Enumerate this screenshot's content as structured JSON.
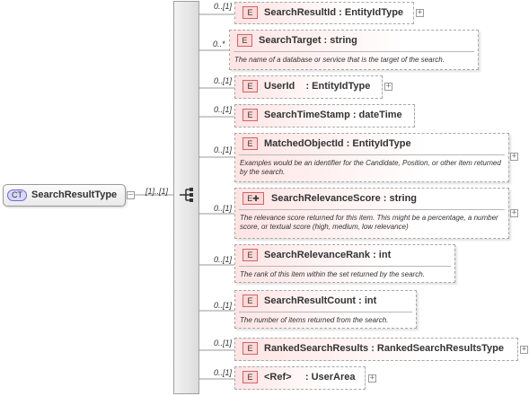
{
  "root": {
    "badge": "CT",
    "name": "SearchResultType",
    "occurrence": "[1]..[1]"
  },
  "elements": [
    {
      "badge": "E",
      "occ": "0..[1]",
      "name": "SearchResultId : EntityIdType",
      "doc": "",
      "expandable": true
    },
    {
      "badge": "E",
      "occ": "0..*",
      "name": "SearchTarget : string",
      "doc": "The name of a database or service that is the target of the search.",
      "expandable": false
    },
    {
      "badge": "E",
      "occ": "0..[1]",
      "name": "UserId    : EntityIdType",
      "doc": "",
      "expandable": true
    },
    {
      "badge": "E",
      "occ": "0..[1]",
      "name": "SearchTimeStamp : dateTime",
      "doc": "",
      "expandable": false
    },
    {
      "badge": "E",
      "occ": "0..[1]",
      "name": "MatchedObjectId : EntityIdType",
      "doc": "Examples would be an identifier for the Candidate, Position, or other item returned by the search.",
      "expandable": true
    },
    {
      "badge": "E✚",
      "occ": "0..[1]",
      "name": "SearchRelevanceScore : string",
      "doc": "The relevance score returned for this item. This might be a percentage, a number score, or textual score (high, medium, low relevance)",
      "expandable": true
    },
    {
      "badge": "E",
      "occ": "0..[1]",
      "name": "SearchRelevanceRank : int",
      "doc": "The rank of this item within the set returned by the search.",
      "expandable": false
    },
    {
      "badge": "E",
      "occ": "0..[1]",
      "name": "SearchResultCount : int",
      "doc": "The number of items returned from the search.",
      "expandable": false
    },
    {
      "badge": "E",
      "occ": "0..[1]",
      "name": "RankedSearchResults : RankedSearchResultsType",
      "doc": "",
      "expandable": true
    },
    {
      "badge": "E",
      "occ": "0..[1]",
      "name": "<Ref>     : UserArea",
      "doc": "",
      "expandable": true
    }
  ],
  "colors": {
    "element_fill": "#ffe4e4",
    "element_badge": "#ffd8d8",
    "complex_type_badge": "#d8d8ff",
    "connector": "#999999"
  },
  "icons": {
    "sequence": "sequence-compositor-icon",
    "expand": "plus-expand-icon"
  }
}
